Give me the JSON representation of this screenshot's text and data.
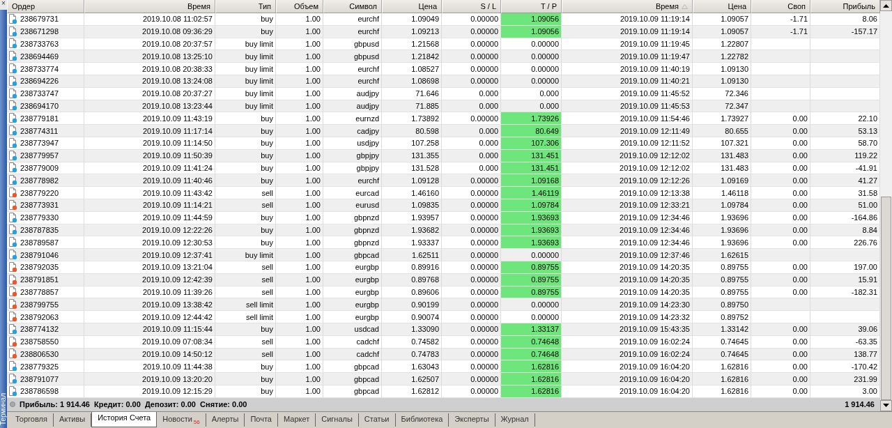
{
  "panel": {
    "title": "Терминал",
    "close": "×"
  },
  "table": {
    "columns": [
      {
        "label": "Ордер",
        "sorted": false
      },
      {
        "label": "Время",
        "sorted": false
      },
      {
        "label": "Тип",
        "sorted": false
      },
      {
        "label": "Объем",
        "sorted": false
      },
      {
        "label": "Символ",
        "sorted": false
      },
      {
        "label": "Цена",
        "sorted": false
      },
      {
        "label": "S / L",
        "sorted": false
      },
      {
        "label": "T / P",
        "sorted": false
      },
      {
        "label": "Время",
        "sorted": true
      },
      {
        "label": "Цена",
        "sorted": false
      },
      {
        "label": "Своп",
        "sorted": false
      },
      {
        "label": "Прибыль",
        "sorted": false
      }
    ],
    "rows": [
      {
        "kind": "buy",
        "order": "238679731",
        "open_time": "2019.10.08 11:02:57",
        "type": "buy",
        "volume": "1.00",
        "symbol": "eurchf",
        "open_price": "1.09049",
        "sl": "0.00000",
        "tp": "1.09056",
        "tp_hit": true,
        "close_time": "2019.10.09 11:19:14",
        "close_price": "1.09057",
        "swap": "-1.71",
        "profit": "8.06"
      },
      {
        "kind": "buy",
        "order": "238671298",
        "open_time": "2019.10.08 09:36:29",
        "type": "buy",
        "volume": "1.00",
        "symbol": "eurchf",
        "open_price": "1.09213",
        "sl": "0.00000",
        "tp": "1.09056",
        "tp_hit": true,
        "close_time": "2019.10.09 11:19:14",
        "close_price": "1.09057",
        "swap": "-1.71",
        "profit": "-157.17"
      },
      {
        "kind": "buy",
        "order": "238733763",
        "open_time": "2019.10.08 20:37:57",
        "type": "buy limit",
        "volume": "1.00",
        "symbol": "gbpusd",
        "open_price": "1.21568",
        "sl": "0.00000",
        "tp": "0.00000",
        "tp_hit": false,
        "close_time": "2019.10.09 11:19:45",
        "close_price": "1.22807"
      },
      {
        "kind": "buy",
        "order": "238694469",
        "open_time": "2019.10.08 13:25:10",
        "type": "buy limit",
        "volume": "1.00",
        "symbol": "gbpusd",
        "open_price": "1.21842",
        "sl": "0.00000",
        "tp": "0.00000",
        "tp_hit": false,
        "close_time": "2019.10.09 11:19:47",
        "close_price": "1.22782"
      },
      {
        "kind": "buy",
        "order": "238733774",
        "open_time": "2019.10.08 20:38:33",
        "type": "buy limit",
        "volume": "1.00",
        "symbol": "eurchf",
        "open_price": "1.08527",
        "sl": "0.00000",
        "tp": "0.00000",
        "tp_hit": false,
        "close_time": "2019.10.09 11:40:19",
        "close_price": "1.09130"
      },
      {
        "kind": "buy",
        "order": "238694226",
        "open_time": "2019.10.08 13:24:08",
        "type": "buy limit",
        "volume": "1.00",
        "symbol": "eurchf",
        "open_price": "1.08698",
        "sl": "0.00000",
        "tp": "0.00000",
        "tp_hit": false,
        "close_time": "2019.10.09 11:40:21",
        "close_price": "1.09130"
      },
      {
        "kind": "buy",
        "order": "238733747",
        "open_time": "2019.10.08 20:37:27",
        "type": "buy limit",
        "volume": "1.00",
        "symbol": "audjpy",
        "open_price": "71.646",
        "sl": "0.000",
        "tp": "0.000",
        "tp_hit": false,
        "close_time": "2019.10.09 11:45:52",
        "close_price": "72.346"
      },
      {
        "kind": "buy",
        "order": "238694170",
        "open_time": "2019.10.08 13:23:44",
        "type": "buy limit",
        "volume": "1.00",
        "symbol": "audjpy",
        "open_price": "71.885",
        "sl": "0.000",
        "tp": "0.000",
        "tp_hit": false,
        "close_time": "2019.10.09 11:45:53",
        "close_price": "72.347"
      },
      {
        "kind": "buy",
        "order": "238779181",
        "open_time": "2019.10.09 11:43:19",
        "type": "buy",
        "volume": "1.00",
        "symbol": "eurnzd",
        "open_price": "1.73892",
        "sl": "0.00000",
        "tp": "1.73926",
        "tp_hit": true,
        "close_time": "2019.10.09 11:54:46",
        "close_price": "1.73927",
        "swap": "0.00",
        "profit": "22.10"
      },
      {
        "kind": "buy",
        "order": "238774311",
        "open_time": "2019.10.09 11:17:14",
        "type": "buy",
        "volume": "1.00",
        "symbol": "cadjpy",
        "open_price": "80.598",
        "sl": "0.000",
        "tp": "80.649",
        "tp_hit": true,
        "close_time": "2019.10.09 12:11:49",
        "close_price": "80.655",
        "swap": "0.00",
        "profit": "53.13"
      },
      {
        "kind": "buy",
        "order": "238773947",
        "open_time": "2019.10.09 11:14:50",
        "type": "buy",
        "volume": "1.00",
        "symbol": "usdjpy",
        "open_price": "107.258",
        "sl": "0.000",
        "tp": "107.306",
        "tp_hit": true,
        "close_time": "2019.10.09 12:11:52",
        "close_price": "107.321",
        "swap": "0.00",
        "profit": "58.70"
      },
      {
        "kind": "buy",
        "order": "238779957",
        "open_time": "2019.10.09 11:50:39",
        "type": "buy",
        "volume": "1.00",
        "symbol": "gbpjpy",
        "open_price": "131.355",
        "sl": "0.000",
        "tp": "131.451",
        "tp_hit": true,
        "close_time": "2019.10.09 12:12:02",
        "close_price": "131.483",
        "swap": "0.00",
        "profit": "119.22"
      },
      {
        "kind": "buy",
        "order": "238779009",
        "open_time": "2019.10.09 11:41:24",
        "type": "buy",
        "volume": "1.00",
        "symbol": "gbpjpy",
        "open_price": "131.528",
        "sl": "0.000",
        "tp": "131.451",
        "tp_hit": true,
        "close_time": "2019.10.09 12:12:02",
        "close_price": "131.483",
        "swap": "0.00",
        "profit": "-41.91"
      },
      {
        "kind": "buy",
        "order": "238778982",
        "open_time": "2019.10.09 11:40:46",
        "type": "buy",
        "volume": "1.00",
        "symbol": "eurchf",
        "open_price": "1.09128",
        "sl": "0.00000",
        "tp": "1.09168",
        "tp_hit": true,
        "close_time": "2019.10.09 12:12:26",
        "close_price": "1.09169",
        "swap": "0.00",
        "profit": "41.27"
      },
      {
        "kind": "sell",
        "order": "238779220",
        "open_time": "2019.10.09 11:43:42",
        "type": "sell",
        "volume": "1.00",
        "symbol": "eurcad",
        "open_price": "1.46160",
        "sl": "0.00000",
        "tp": "1.46119",
        "tp_hit": true,
        "close_time": "2019.10.09 12:13:38",
        "close_price": "1.46118",
        "swap": "0.00",
        "profit": "31.58"
      },
      {
        "kind": "sell",
        "order": "238773931",
        "open_time": "2019.10.09 11:14:21",
        "type": "sell",
        "volume": "1.00",
        "symbol": "eurusd",
        "open_price": "1.09835",
        "sl": "0.00000",
        "tp": "1.09784",
        "tp_hit": true,
        "close_time": "2019.10.09 12:33:21",
        "close_price": "1.09784",
        "swap": "0.00",
        "profit": "51.00"
      },
      {
        "kind": "buy",
        "order": "238779330",
        "open_time": "2019.10.09 11:44:59",
        "type": "buy",
        "volume": "1.00",
        "symbol": "gbpnzd",
        "open_price": "1.93957",
        "sl": "0.00000",
        "tp": "1.93693",
        "tp_hit": true,
        "close_time": "2019.10.09 12:34:46",
        "close_price": "1.93696",
        "swap": "0.00",
        "profit": "-164.86"
      },
      {
        "kind": "buy",
        "order": "238787835",
        "open_time": "2019.10.09 12:22:26",
        "type": "buy",
        "volume": "1.00",
        "symbol": "gbpnzd",
        "open_price": "1.93682",
        "sl": "0.00000",
        "tp": "1.93693",
        "tp_hit": true,
        "close_time": "2019.10.09 12:34:46",
        "close_price": "1.93696",
        "swap": "0.00",
        "profit": "8.84"
      },
      {
        "kind": "buy",
        "order": "238789587",
        "open_time": "2019.10.09 12:30:53",
        "type": "buy",
        "volume": "1.00",
        "symbol": "gbpnzd",
        "open_price": "1.93337",
        "sl": "0.00000",
        "tp": "1.93693",
        "tp_hit": true,
        "close_time": "2019.10.09 12:34:46",
        "close_price": "1.93696",
        "swap": "0.00",
        "profit": "226.76"
      },
      {
        "kind": "buy",
        "order": "238791046",
        "open_time": "2019.10.09 12:37:41",
        "type": "buy limit",
        "volume": "1.00",
        "symbol": "gbpcad",
        "open_price": "1.62511",
        "sl": "0.00000",
        "tp": "0.00000",
        "tp_hit": false,
        "close_time": "2019.10.09 12:37:46",
        "close_price": "1.62615"
      },
      {
        "kind": "sell",
        "order": "238792035",
        "open_time": "2019.10.09 13:21:04",
        "type": "sell",
        "volume": "1.00",
        "symbol": "eurgbp",
        "open_price": "0.89916",
        "sl": "0.00000",
        "tp": "0.89755",
        "tp_hit": true,
        "close_time": "2019.10.09 14:20:35",
        "close_price": "0.89755",
        "swap": "0.00",
        "profit": "197.00"
      },
      {
        "kind": "sell",
        "order": "238791851",
        "open_time": "2019.10.09 12:42:39",
        "type": "sell",
        "volume": "1.00",
        "symbol": "eurgbp",
        "open_price": "0.89768",
        "sl": "0.00000",
        "tp": "0.89755",
        "tp_hit": true,
        "close_time": "2019.10.09 14:20:35",
        "close_price": "0.89755",
        "swap": "0.00",
        "profit": "15.91"
      },
      {
        "kind": "sell",
        "order": "238778857",
        "open_time": "2019.10.09 11:39:26",
        "type": "sell",
        "volume": "1.00",
        "symbol": "eurgbp",
        "open_price": "0.89606",
        "sl": "0.00000",
        "tp": "0.89755",
        "tp_hit": true,
        "close_time": "2019.10.09 14:20:35",
        "close_price": "0.89755",
        "swap": "0.00",
        "profit": "-182.31"
      },
      {
        "kind": "sell",
        "order": "238799755",
        "open_time": "2019.10.09 13:38:42",
        "type": "sell limit",
        "volume": "1.00",
        "symbol": "eurgbp",
        "open_price": "0.90199",
        "sl": "0.00000",
        "tp": "0.00000",
        "tp_hit": false,
        "close_time": "2019.10.09 14:23:30",
        "close_price": "0.89750"
      },
      {
        "kind": "sell",
        "order": "238792063",
        "open_time": "2019.10.09 12:44:42",
        "type": "sell limit",
        "volume": "1.00",
        "symbol": "eurgbp",
        "open_price": "0.90074",
        "sl": "0.00000",
        "tp": "0.00000",
        "tp_hit": false,
        "close_time": "2019.10.09 14:23:32",
        "close_price": "0.89752"
      },
      {
        "kind": "buy",
        "order": "238774132",
        "open_time": "2019.10.09 11:15:44",
        "type": "buy",
        "volume": "1.00",
        "symbol": "usdcad",
        "open_price": "1.33090",
        "sl": "0.00000",
        "tp": "1.33137",
        "tp_hit": true,
        "close_time": "2019.10.09 15:43:35",
        "close_price": "1.33142",
        "swap": "0.00",
        "profit": "39.06"
      },
      {
        "kind": "sell",
        "order": "238758550",
        "open_time": "2019.10.09 07:08:34",
        "type": "sell",
        "volume": "1.00",
        "symbol": "cadchf",
        "open_price": "0.74582",
        "sl": "0.00000",
        "tp": "0.74648",
        "tp_hit": true,
        "close_time": "2019.10.09 16:02:24",
        "close_price": "0.74645",
        "swap": "0.00",
        "profit": "-63.35"
      },
      {
        "kind": "sell",
        "order": "238806530",
        "open_time": "2019.10.09 14:50:12",
        "type": "sell",
        "volume": "1.00",
        "symbol": "cadchf",
        "open_price": "0.74783",
        "sl": "0.00000",
        "tp": "0.74648",
        "tp_hit": true,
        "close_time": "2019.10.09 16:02:24",
        "close_price": "0.74645",
        "swap": "0.00",
        "profit": "138.77"
      },
      {
        "kind": "buy",
        "order": "238779325",
        "open_time": "2019.10.09 11:44:38",
        "type": "buy",
        "volume": "1.00",
        "symbol": "gbpcad",
        "open_price": "1.63043",
        "sl": "0.00000",
        "tp": "1.62816",
        "tp_hit": true,
        "close_time": "2019.10.09 16:04:20",
        "close_price": "1.62816",
        "swap": "0.00",
        "profit": "-170.42"
      },
      {
        "kind": "buy",
        "order": "238791077",
        "open_time": "2019.10.09 13:20:20",
        "type": "buy",
        "volume": "1.00",
        "symbol": "gbpcad",
        "open_price": "1.62507",
        "sl": "0.00000",
        "tp": "1.62816",
        "tp_hit": true,
        "close_time": "2019.10.09 16:04:20",
        "close_price": "1.62816",
        "swap": "0.00",
        "profit": "231.99"
      },
      {
        "kind": "buy",
        "order": "238786598",
        "open_time": "2019.10.09 12:15:29",
        "type": "buy",
        "volume": "1.00",
        "symbol": "gbpcad",
        "open_price": "1.62812",
        "sl": "0.00000",
        "tp": "1.62816",
        "tp_hit": true,
        "close_time": "2019.10.09 16:04:20",
        "close_price": "1.62816",
        "swap": "0.00",
        "profit": "3.00"
      }
    ]
  },
  "summary": {
    "text": "Прибыль: 1 914.46  Кредит: 0.00  Депозит: 0.00  Снятие: 0.00",
    "total": "1 914.46"
  },
  "tabs": [
    {
      "label": "Торговля",
      "selected": false
    },
    {
      "label": "Активы",
      "selected": false
    },
    {
      "label": "История Счета",
      "selected": true
    },
    {
      "label": "Новости",
      "selected": false,
      "badge": "56"
    },
    {
      "label": "Алерты",
      "selected": false
    },
    {
      "label": "Почта",
      "selected": false
    },
    {
      "label": "Маркет",
      "selected": false
    },
    {
      "label": "Сигналы",
      "selected": false
    },
    {
      "label": "Статьи",
      "selected": false
    },
    {
      "label": "Библиотека",
      "selected": false
    },
    {
      "label": "Эксперты",
      "selected": false
    },
    {
      "label": "Журнал",
      "selected": false
    }
  ]
}
